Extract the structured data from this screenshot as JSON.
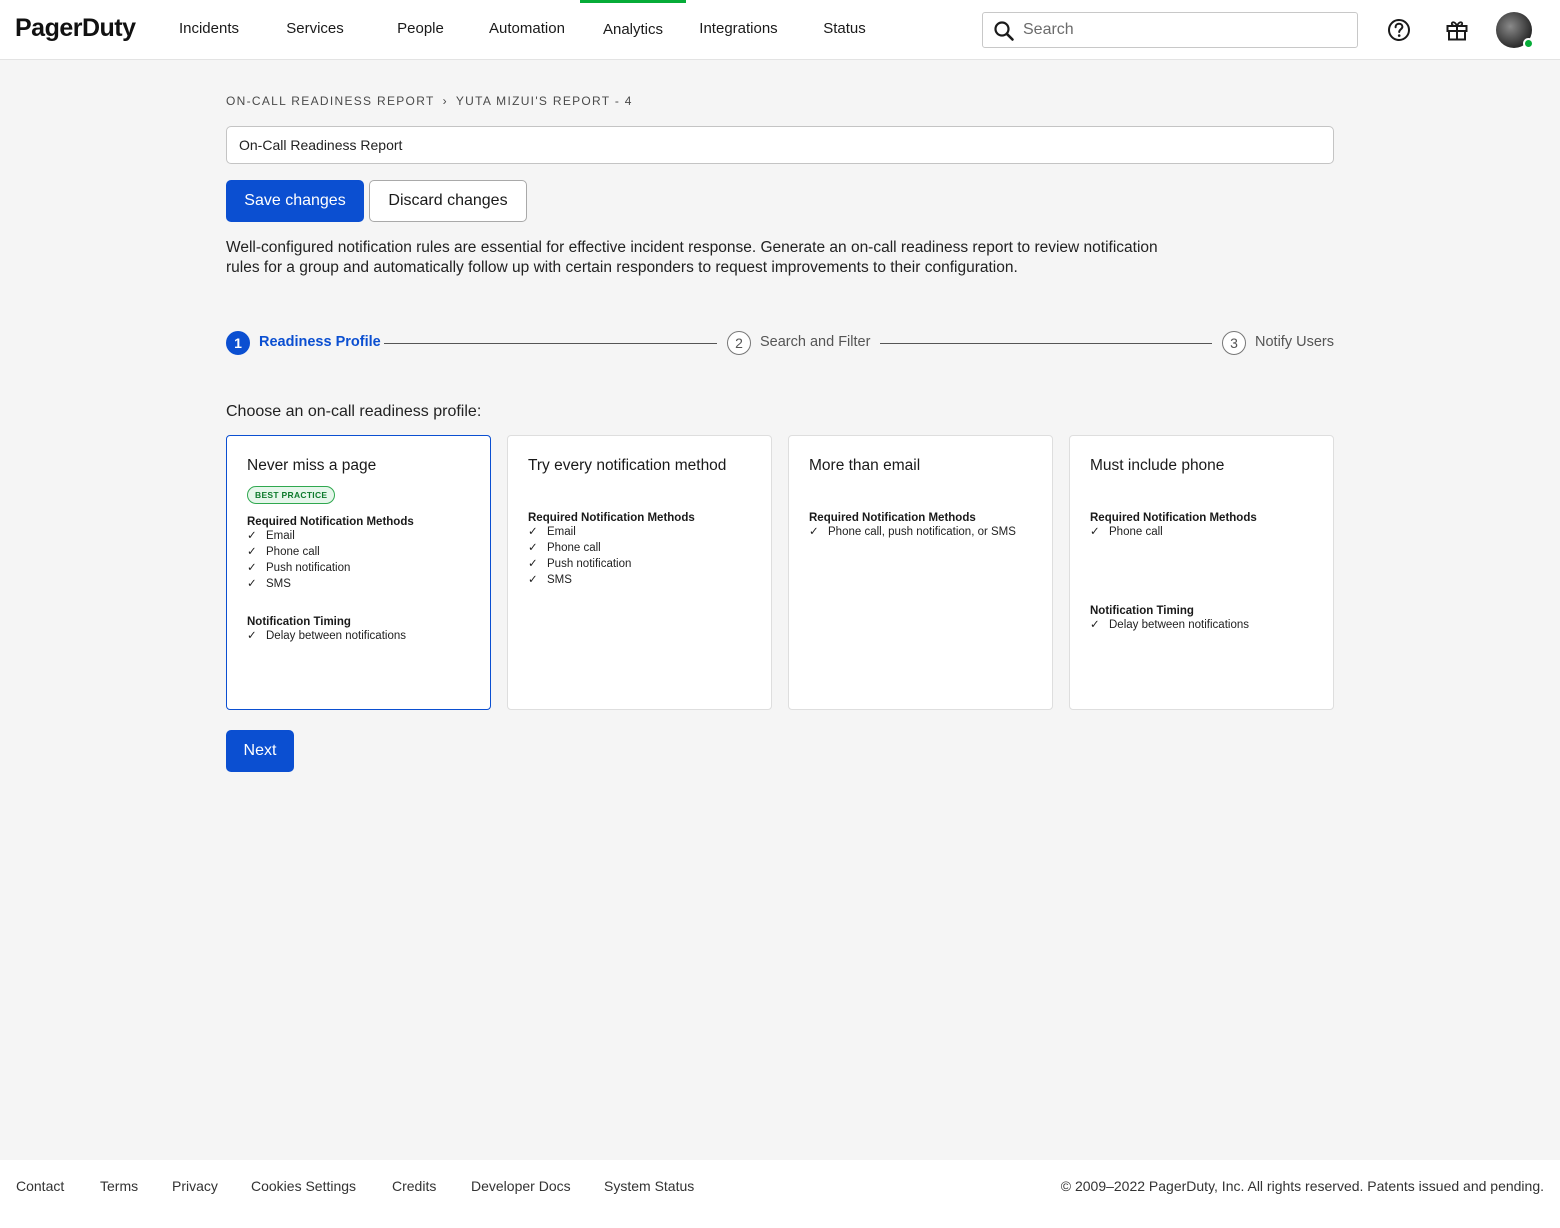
{
  "app": {
    "logo": "PagerDuty"
  },
  "nav": {
    "items": [
      "Incidents",
      "Services",
      "People",
      "Automation",
      "Analytics",
      "Integrations",
      "Status"
    ],
    "active": "Analytics",
    "active_color": "#06ac38"
  },
  "search": {
    "placeholder": "Search",
    "value": "",
    "icon": "search-icon"
  },
  "header_icons": [
    "help-icon",
    "gift-icon",
    "avatar"
  ],
  "breadcrumb": {
    "items": [
      "On-Call Readiness Report",
      "Yuta Mizui's Report - 4"
    ],
    "separator": "›"
  },
  "report": {
    "name_value": "On-Call Readiness Report"
  },
  "actions": {
    "save_label": "Save changes",
    "discard_label": "Discard changes",
    "next_label": "Next"
  },
  "description": "Well-configured notification rules are essential for effective incident response. Generate an on-call readiness report to review notification rules for a group and automatically follow up with certain responders to request improvements to their configuration.",
  "stepper": {
    "steps": [
      {
        "number": "1",
        "label": "Readiness Profile",
        "active": true
      },
      {
        "number": "2",
        "label": "Search and Filter",
        "active": false
      },
      {
        "number": "3",
        "label": "Notify Users",
        "active": false
      }
    ]
  },
  "profiles": {
    "prompt": "Choose an on-call readiness profile:",
    "cards": [
      {
        "title": "Never miss a page",
        "badge": "BEST PRACTICE",
        "selected": true,
        "methods_heading": "Required Notification Methods",
        "methods": [
          "Email",
          "Phone call",
          "Push notification",
          "SMS"
        ],
        "timing_heading": "Notification Timing",
        "timing": [
          "Delay between notifications"
        ]
      },
      {
        "title": "Try every notification method",
        "selected": false,
        "methods_heading": "Required Notification Methods",
        "methods": [
          "Email",
          "Phone call",
          "Push notification",
          "SMS"
        ]
      },
      {
        "title": "More than email",
        "selected": false,
        "methods_heading": "Required Notification Methods",
        "methods": [
          "Phone call, push notification, or SMS"
        ]
      },
      {
        "title": "Must include phone",
        "selected": false,
        "methods_heading": "Required Notification Methods",
        "methods": [
          "Phone call"
        ],
        "timing_heading": "Notification Timing",
        "timing": [
          "Delay between notifications"
        ]
      }
    ],
    "check_glyph": "✓"
  },
  "colors": {
    "primary": "#0b4fd1",
    "badge_green": "#2fa84f",
    "status_online": "#06ac38"
  },
  "footer": {
    "links": [
      "Contact",
      "Terms",
      "Privacy",
      "Cookies Settings",
      "Credits",
      "Developer Docs",
      "System Status"
    ],
    "copyright": "© 2009–2022 PagerDuty, Inc. All rights reserved. Patents issued and pending."
  }
}
